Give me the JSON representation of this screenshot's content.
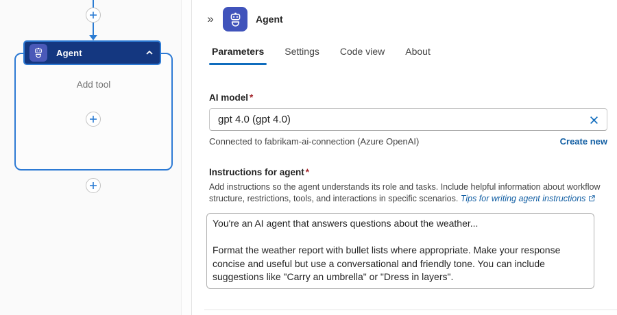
{
  "colors": {
    "brand_blue": "#0f6cbd",
    "link_blue": "#115ea3",
    "connector_blue": "#2b7cd3",
    "selection_blue": "#2d7ad4",
    "node_header_bg": "#143780",
    "node_icon_bg": "#4a59b8",
    "panel_icon_bg": "#4053bb",
    "required_red": "#a4262c"
  },
  "icons": {
    "robot": "robot-icon (white outline robot head + body)",
    "collapse": "double-chevron-right »",
    "chevron_up": "chevron-up ^",
    "plus": "+",
    "dismiss": "✕",
    "external_link": "open-in-new-window"
  },
  "canvas": {
    "node": {
      "title": "Agent",
      "body_hint": "Add tool"
    }
  },
  "panel": {
    "collapse_glyph": "»",
    "header": {
      "title": "Agent"
    },
    "tabs": [
      {
        "label": "Parameters",
        "selected": true
      },
      {
        "label": "Settings",
        "selected": false
      },
      {
        "label": "Code view",
        "selected": false
      },
      {
        "label": "About",
        "selected": false
      }
    ],
    "ai_model": {
      "label": "AI model",
      "required": "*",
      "value": "gpt 4.0 (gpt 4.0)",
      "connection_text": "Connected to fabrikam-ai-connection (Azure OpenAI)",
      "create_new_label": "Create new"
    },
    "instructions": {
      "label": "Instructions for agent",
      "required": "*",
      "help_text": "Add instructions so the agent understands its role and tasks. Include helpful information about workflow structure, restrictions, tools, and interactions in specific scenarios. ",
      "help_link": "Tips for writing agent instructions",
      "value": "You're an AI agent that answers questions about the weather...\n\nFormat the weather report with bullet lists where appropriate. Make your response concise and useful but use a conversational and friendly tone. You can include suggestions like \"Carry an umbrella\" or \"Dress in layers\"."
    }
  }
}
